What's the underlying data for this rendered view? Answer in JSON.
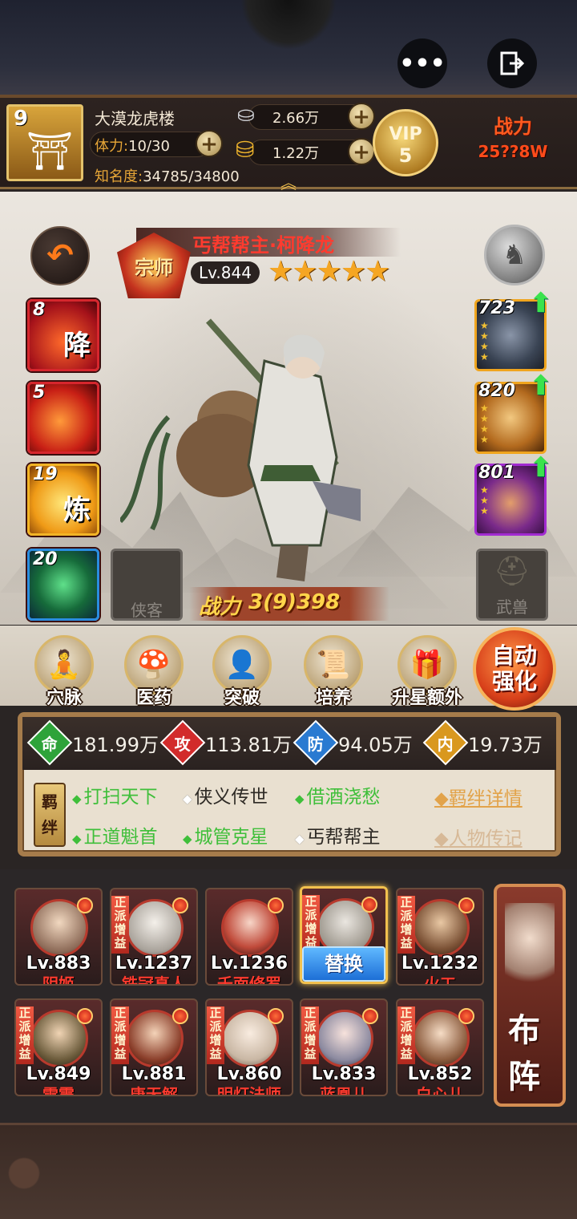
{
  "header": {
    "guild_level": "9",
    "guild_name": "大漠龙虎楼",
    "stamina_label": "体力:",
    "stamina_value": "10/30",
    "fame_label": "知名度:",
    "fame_value": "34785/34800",
    "silver": "2.66万",
    "gold": "1.22万",
    "vip_label": "VIP",
    "vip_level": "5",
    "power_label": "战力",
    "power_value": "25??8W"
  },
  "hero": {
    "rank_badge": "宗师",
    "title": "丐帮帮主·柯降龙",
    "level": "Lv.844",
    "stars": "★★★★★",
    "power_label": "战力",
    "power_value": "3(9)398"
  },
  "skills": [
    {
      "num": "8",
      "glyph": "降"
    },
    {
      "num": "5",
      "glyph": ""
    },
    {
      "num": "19",
      "glyph": "炼"
    },
    {
      "num": "20",
      "glyph": ""
    }
  ],
  "slots": {
    "xiake": "侠客",
    "wushou": "武兽"
  },
  "equips": [
    {
      "num": "723",
      "name": "weapon"
    },
    {
      "num": "820",
      "name": "armor"
    },
    {
      "num": "801",
      "name": "treasure"
    }
  ],
  "functions": [
    {
      "label": "穴脉"
    },
    {
      "label": "医药"
    },
    {
      "label": "突破"
    },
    {
      "label": "培养"
    },
    {
      "label": "升星额外"
    }
  ],
  "auto_enhance": "自动强化",
  "stats": [
    {
      "key": "命",
      "value": "181.99万",
      "color": "#2ea33a"
    },
    {
      "key": "攻",
      "value": "113.81万",
      "color": "#d22b2b"
    },
    {
      "key": "防",
      "value": "94.05万",
      "color": "#2a7ad1"
    },
    {
      "key": "内",
      "value": "19.73万",
      "color": "#d9981e"
    }
  ],
  "bonds": {
    "label": "羁绊",
    "row1": [
      "打扫天下",
      "侠义传世",
      "借酒浇愁"
    ],
    "row2": [
      "正道魁首",
      "城管克星",
      "丐帮帮主"
    ],
    "detail_link": "羁绊详情",
    "bio_link": "人物传记"
  },
  "roster": [
    {
      "level": "Lv.883",
      "name": "阴姬",
      "tag": ""
    },
    {
      "level": "Lv.1237",
      "name": "铁冠真人",
      "tag": "正派增益"
    },
    {
      "level": "Lv.1236",
      "name": "千面修罗",
      "tag": ""
    },
    {
      "level": "",
      "name": "",
      "tag": "正派增益",
      "replace": "替换"
    },
    {
      "level": "Lv.1232",
      "name": "火工",
      "tag": "正派增益"
    },
    {
      "level": "Lv.849",
      "name": "雷震",
      "tag": "正派增益"
    },
    {
      "level": "Lv.881",
      "name": "唐无解",
      "tag": "正派增益"
    },
    {
      "level": "Lv.860",
      "name": "明灯法师",
      "tag": "正派增益"
    },
    {
      "level": "Lv.833",
      "name": "蓝凰儿",
      "tag": "正派增益"
    },
    {
      "level": "Lv.852",
      "name": "白心儿",
      "tag": "正派增益"
    }
  ],
  "formation": "布阵"
}
